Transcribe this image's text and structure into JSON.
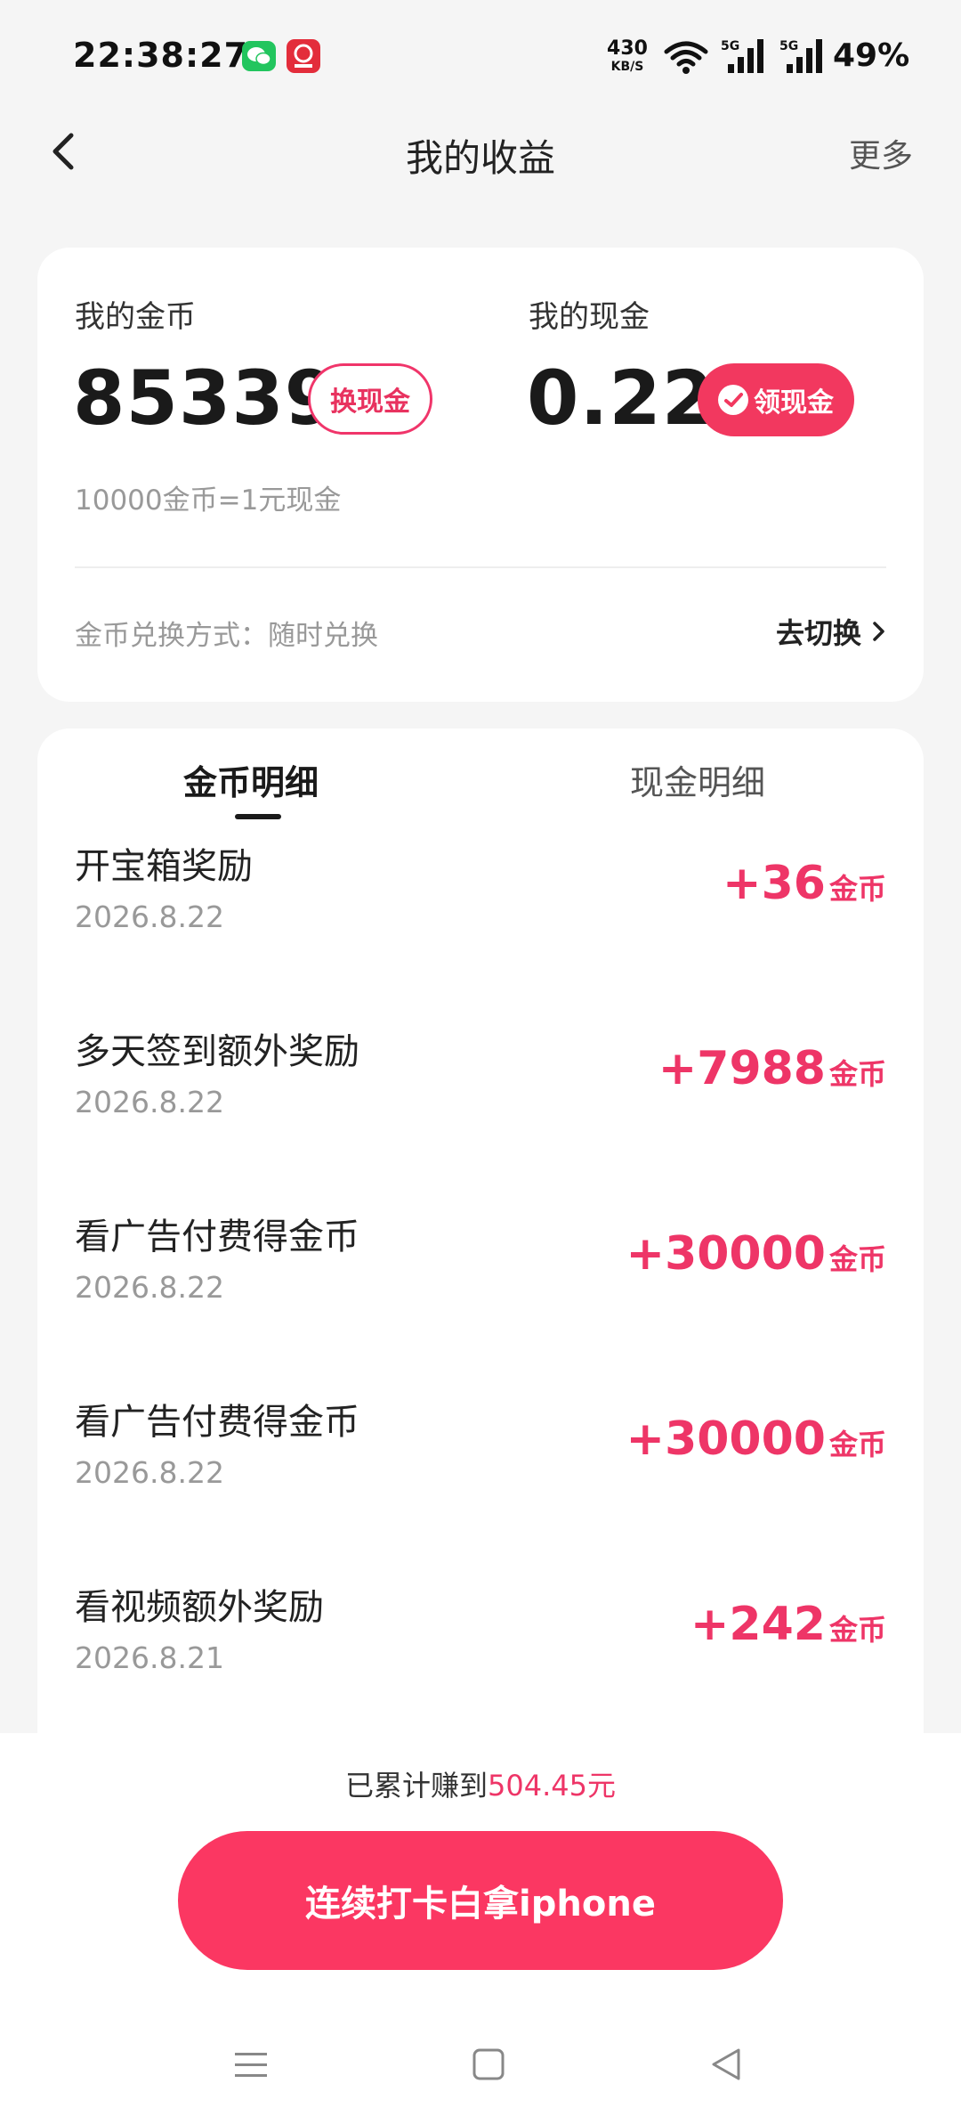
{
  "status_bar": {
    "time": "22:38:27",
    "network_speed": "430",
    "network_unit": "KB/S",
    "battery": "49%",
    "icons": [
      "wechat-icon",
      "app-notification-icon",
      "wifi-icon",
      "5g-signal-icon",
      "5g-signal-icon"
    ]
  },
  "header": {
    "title": "我的收益",
    "more": "更多",
    "back_icon": "chevron-left-icon"
  },
  "balance": {
    "coin_label": "我的金币",
    "coin_value": "85339",
    "exchange_button": "换现金",
    "cash_label": "我的现金",
    "cash_value": "0.22",
    "withdraw_button": "领现金",
    "rate_text": "10000金币=1元现金",
    "mode_text": "金币兑换方式：随时兑换",
    "switch_label": "去切换"
  },
  "tabs": {
    "coin_detail": "金币明细",
    "cash_detail": "现金明细",
    "active": "coin_detail"
  },
  "records": [
    {
      "title": "开宝箱奖励",
      "date": "2026.8.22",
      "amount": "+36",
      "unit": "金币"
    },
    {
      "title": "多天签到额外奖励",
      "date": "2026.8.22",
      "amount": "+7988",
      "unit": "金币"
    },
    {
      "title": "看广告付费得金币",
      "date": "2026.8.22",
      "amount": "+30000",
      "unit": "金币"
    },
    {
      "title": "看广告付费得金币",
      "date": "2026.8.22",
      "amount": "+30000",
      "unit": "金币"
    },
    {
      "title": "看视频额外奖励",
      "date": "2026.8.21",
      "amount": "+242",
      "unit": "金币"
    }
  ],
  "footer": {
    "earned_prefix": "已累计赚到",
    "earned_amount": "504.45元",
    "cta_button": "连续打卡白拿iphone"
  },
  "colors": {
    "accent": "#f2385f",
    "amount": "#ee3567",
    "background": "#f5f5f5"
  }
}
